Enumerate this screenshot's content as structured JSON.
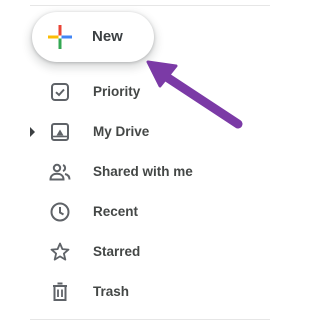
{
  "new_button": {
    "label": "New",
    "icon": "google-plus-icon"
  },
  "nav": {
    "items": [
      {
        "label": "Priority",
        "icon": "priority-check-icon"
      },
      {
        "label": "My Drive",
        "icon": "my-drive-icon",
        "expandable": true
      },
      {
        "label": "Shared with me",
        "icon": "shared-people-icon"
      },
      {
        "label": "Recent",
        "icon": "clock-icon"
      },
      {
        "label": "Starred",
        "icon": "star-icon"
      },
      {
        "label": "Trash",
        "icon": "trash-icon"
      }
    ]
  },
  "annotation": {
    "icon": "pointer-arrow-icon",
    "color": "#7b3aa6"
  },
  "colors": {
    "google_blue": "#4285f4",
    "google_red": "#ea4335",
    "google_yellow": "#fbbc04",
    "google_green": "#34a853",
    "icon_gray": "#5f6368"
  }
}
